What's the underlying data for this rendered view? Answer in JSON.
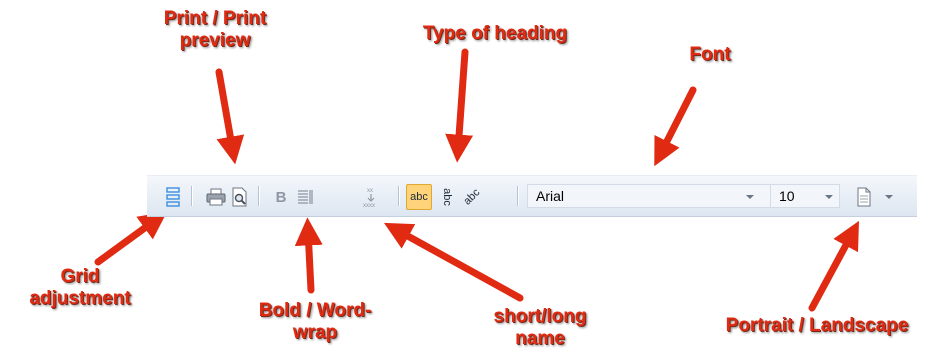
{
  "annotations": {
    "print_preview": "Print /  Print\npreview",
    "type_of_heading": "Type of heading",
    "font": "Font",
    "grid_adjustment": "Grid\nadjustment",
    "bold_wordwrap": "Bold / Word-\nwrap",
    "short_long_name": "short/long\nname",
    "portrait_landscape": "Portrait / Landscape"
  },
  "toolbar": {
    "font_value": "Arial",
    "size_value": "10",
    "bold_glyph": "B",
    "heading_normal": "abc",
    "heading_vertical": "abc",
    "heading_diagonal": "abc",
    "icons": [
      "grid-adjust-icon",
      "print-icon",
      "print-preview-icon",
      "bold-icon",
      "word-wrap-icon",
      "short-long-name-icon",
      "heading-horizontal-icon",
      "heading-vertical-icon",
      "heading-diagonal-icon",
      "page-orientation-icon"
    ]
  },
  "colors": {
    "annotation": "#e02a12",
    "active": "#ffd37a",
    "grid_icon": "#3b8fe0"
  }
}
